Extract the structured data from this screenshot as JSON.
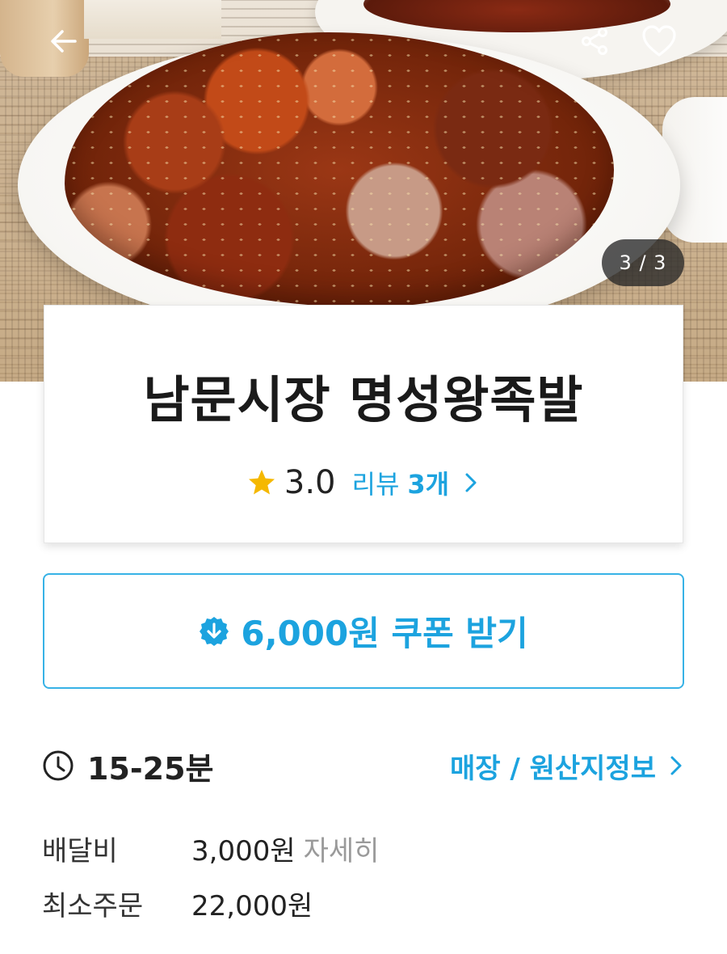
{
  "hero": {
    "image_counter": "3 / 3",
    "icons": [
      "back-arrow-icon",
      "share-icon",
      "heart-icon"
    ]
  },
  "store": {
    "name": "남문시장 명성왕족발",
    "rating": "3.0",
    "review_label": "리뷰",
    "review_count": "3개"
  },
  "coupon": {
    "label": "6,000원 쿠폰 받기"
  },
  "delivery": {
    "time": "15-25분",
    "store_info_link": "매장 / 원산지정보"
  },
  "fees": [
    {
      "label": "배달비",
      "value": "3,000원",
      "detail": "자세히"
    },
    {
      "label": "최소주문",
      "value": "22,000원"
    }
  ],
  "colors": {
    "accent": "#1ca3df",
    "star": "#f5b800",
    "counter_bg": "#2a2a2a"
  }
}
